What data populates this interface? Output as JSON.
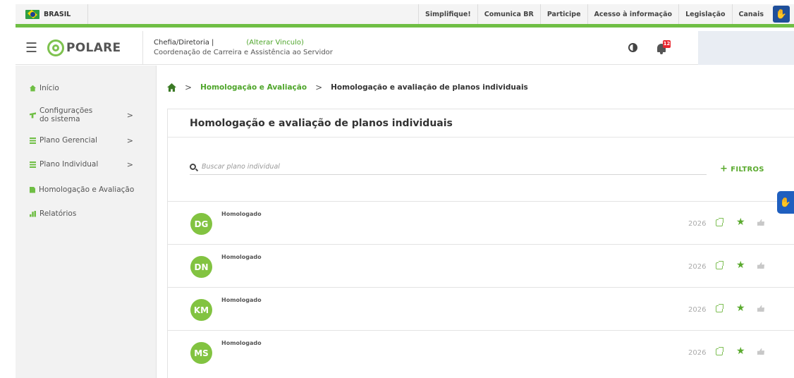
{
  "gov_bar": {
    "brand": "BRASIL",
    "links": [
      "Simplifique!",
      "Comunica BR",
      "Participe",
      "Acesso à informação",
      "Legislação",
      "Canais"
    ]
  },
  "header": {
    "logo_text": "POLARE",
    "role_title": "Chefia/Diretoria |",
    "role_change": "(Alterar Vinculo)",
    "role_unit": "Coordenação de Carreira e Assistência ao Servidor",
    "notification_count": "12"
  },
  "sidebar": {
    "items": [
      {
        "label": "Início",
        "icon": "home-icon"
      },
      {
        "label": "Configurações do sistema",
        "icon": "config-icon",
        "chevron": ">"
      },
      {
        "label": "Plano Gerencial",
        "icon": "list-icon",
        "chevron": ">"
      },
      {
        "label": "Plano Individual",
        "icon": "list-icon",
        "chevron": ">"
      },
      {
        "label": "Homologação e Avaliação",
        "icon": "document-icon"
      },
      {
        "label": "Relatórios",
        "icon": "chart-icon"
      }
    ]
  },
  "breadcrumb": {
    "separator": ">",
    "link": "Homologação e Avaliação",
    "current": "Homologação e avaliação de planos individuais"
  },
  "card": {
    "title": "Homologação e avaliação de planos individuais",
    "search_placeholder": "Buscar plano individual",
    "filters_plus": "+",
    "filters_label": "FILTROS"
  },
  "plans": [
    {
      "initials": "DG",
      "status": "Homologado",
      "year": "2026"
    },
    {
      "initials": "DN",
      "status": "Homologado",
      "year": "2026"
    },
    {
      "initials": "KM",
      "status": "Homologado",
      "year": "2026"
    },
    {
      "initials": "MS",
      "status": "Homologado",
      "year": "2026"
    }
  ],
  "colors": {
    "accent": "#6fbe44",
    "link": "#4ea52a",
    "avatar": "#82c341",
    "badge": "#e8272f"
  }
}
